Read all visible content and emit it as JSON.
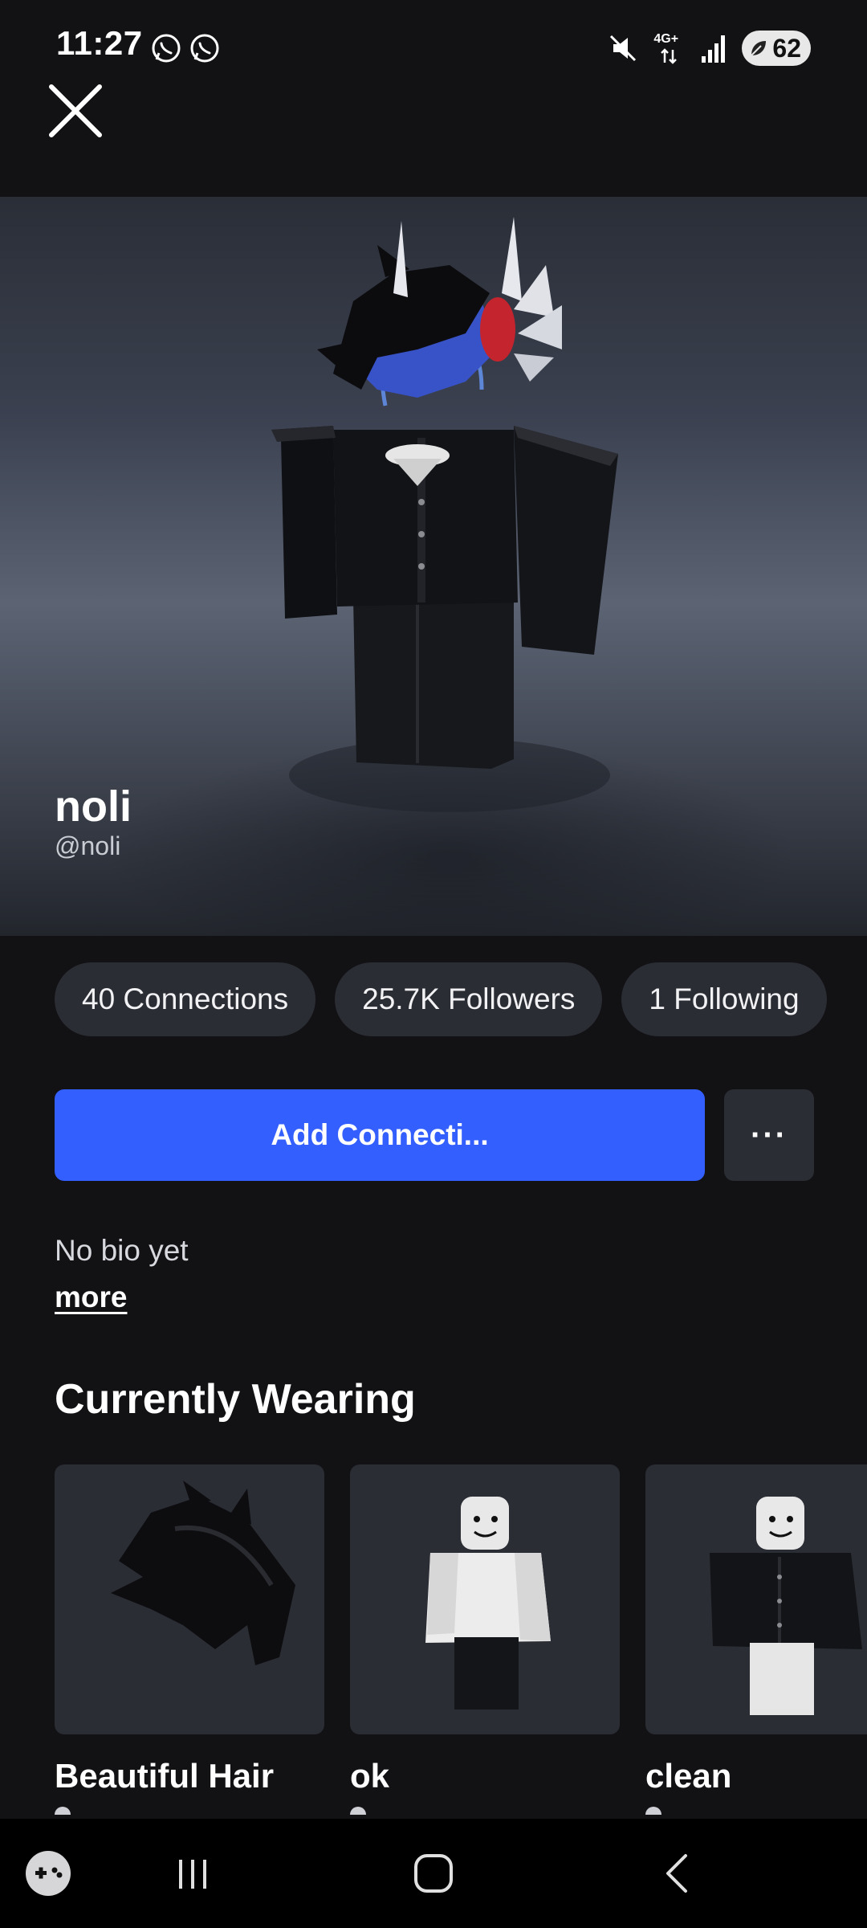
{
  "status_bar": {
    "time": "11:27",
    "network": "4G+",
    "battery": "62"
  },
  "profile": {
    "display_name": "noli",
    "username": "@noli"
  },
  "stats": [
    {
      "label": "40 Connections"
    },
    {
      "label": "25.7K Followers"
    },
    {
      "label": "1 Following"
    }
  ],
  "actions": {
    "add_connection": "Add Connecti...",
    "more": "···"
  },
  "bio": {
    "text": "No bio yet",
    "more_link": "more"
  },
  "currently_wearing": {
    "title": "Currently Wearing",
    "items": [
      {
        "name": "Beautiful Hair",
        "icon": "hair-item-icon"
      },
      {
        "name": "ok",
        "icon": "outfit-item-icon"
      },
      {
        "name": "clean",
        "icon": "outfit-item-icon"
      }
    ]
  },
  "colors": {
    "background": "#121215",
    "accent": "#335fff",
    "pill": "#2b2d34"
  }
}
